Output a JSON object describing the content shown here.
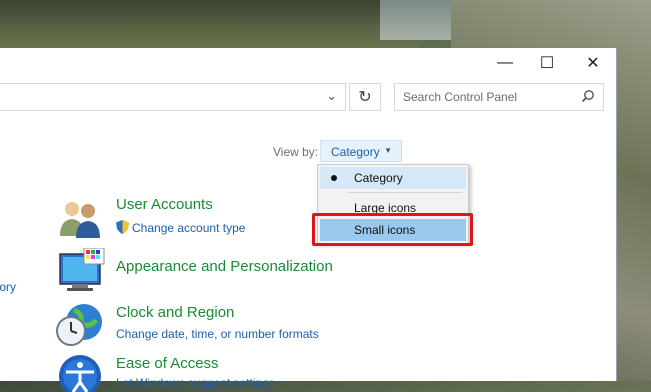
{
  "window": {
    "minimize_glyph": "—",
    "maximize_glyph": "☐",
    "close_glyph": "✕"
  },
  "address_bar": {
    "chevron_glyph": "⌄",
    "refresh_glyph": "↻"
  },
  "search": {
    "placeholder": "Search Control Panel",
    "icon": "search-icon"
  },
  "view_by": {
    "label": "View by:",
    "selected": "Category",
    "arrow_glyph": "▼",
    "options": [
      "Category",
      "Large icons",
      "Small icons"
    ]
  },
  "left_panel": {
    "partial_link": "tory"
  },
  "categories": [
    {
      "title": "User Accounts",
      "links": [
        "Change account type"
      ],
      "icon": "user-accounts-icon"
    },
    {
      "title": "Appearance and Personalization",
      "links": [],
      "icon": "appearance-icon"
    },
    {
      "title": "Clock and Region",
      "links": [
        "Change date, time, or number formats"
      ],
      "icon": "clock-region-icon"
    },
    {
      "title": "Ease of Access",
      "links": [
        "Let Windows suggest settings"
      ],
      "icon": "ease-of-access-icon"
    }
  ],
  "colors": {
    "link_blue": "#1e5fa8",
    "category_green": "#1a8a33",
    "highlight_red": "#e0141c",
    "dropdown_hover": "#99c9ef"
  }
}
